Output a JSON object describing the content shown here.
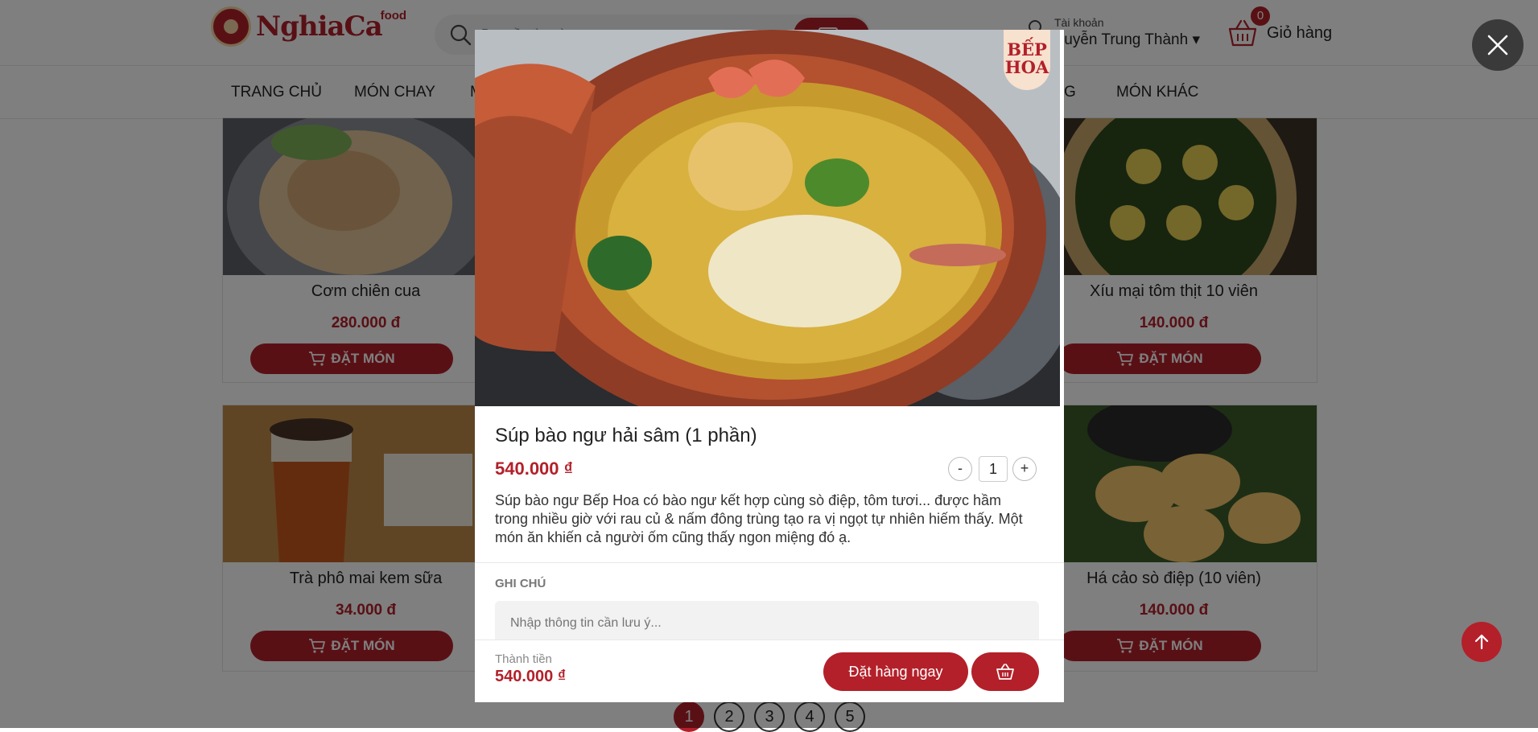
{
  "header": {
    "logo_text": "NghiaCa",
    "logo_sup": "food",
    "search_placeholder": "Bạn cần tìm gì...",
    "account_label": "Tài khoản",
    "account_name": "Nguyễn Trung Thành",
    "cart_count": "0",
    "cart_label": "Giỏ hàng"
  },
  "nav": {
    "items": [
      "TRANG CHỦ",
      "MÓN CHAY",
      "M",
      "G",
      "MÓN KHÁC"
    ]
  },
  "products": [
    {
      "name": "Cơm chiên cua",
      "price": "280.000 đ",
      "button": "ĐẶT MÓN"
    },
    {
      "name": "Xíu mại tôm thịt 10 viên",
      "price": "140.000 đ",
      "button": "ĐẶT MÓN"
    },
    {
      "name": "Trà phô mai kem sữa",
      "price": "34.000 đ",
      "button": "ĐẶT MÓN"
    },
    {
      "name": "Há cảo sò điệp (10 viên)",
      "price": "140.000 đ",
      "button": "ĐẶT MÓN"
    }
  ],
  "pagination": [
    "1",
    "2",
    "3",
    "4",
    "5"
  ],
  "modal": {
    "brand_line1": "BẾP",
    "brand_line2": "HOA",
    "title": "Súp bào ngư hải sâm (1 phần)",
    "price": "540.000 ₫",
    "quantity": "1",
    "minus": "-",
    "plus": "+",
    "description": "Súp bào ngư Bếp Hoa có bào ngư kết hợp cùng sò điệp, tôm tươi... được hầm trong nhiều giờ với rau củ & nấm đông trùng tạo ra vị ngọt tự nhiên hiếm thấy. Một món ăn khiến cả người ốm cũng thấy ngon miệng đó ạ.",
    "note_label": "GHI CHÚ",
    "note_placeholder": "Nhập thông tin cần lưu ý...",
    "total_label": "Thành tiền",
    "total_value": "540.000 ₫",
    "order_button": "Đặt hàng ngay"
  },
  "colors": {
    "brand_red": "#b3202a",
    "overlay": "rgba(0,0,0,0.5)"
  }
}
